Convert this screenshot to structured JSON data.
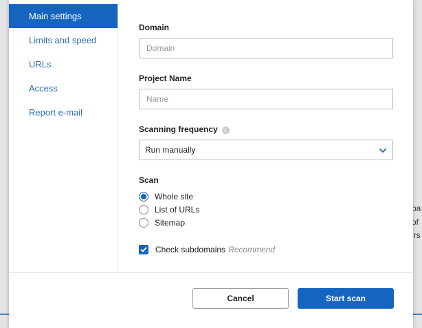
{
  "background": {
    "right_text_fragments": [
      "pa",
      "of",
      "irs"
    ]
  },
  "sidebar": {
    "items": [
      {
        "label": "Main settings",
        "active": true
      },
      {
        "label": "Limits and speed",
        "active": false
      },
      {
        "label": "URLs",
        "active": false
      },
      {
        "label": "Access",
        "active": false
      },
      {
        "label": "Report e-mail",
        "active": false
      }
    ]
  },
  "form": {
    "domain": {
      "label": "Domain",
      "placeholder": "Domain",
      "value": ""
    },
    "project_name": {
      "label": "Project Name",
      "placeholder": "Name",
      "value": ""
    },
    "scanning_frequency": {
      "label": "Scanning frequency",
      "info_icon": "info-icon",
      "selected": "Run manually"
    },
    "scan": {
      "label": "Scan",
      "options": [
        {
          "label": "Whole site",
          "checked": true
        },
        {
          "label": "List of URLs",
          "checked": false
        },
        {
          "label": "Sitemap",
          "checked": false
        }
      ]
    },
    "check_subdomains": {
      "label": "Check subdomains",
      "hint": "Recommend",
      "checked": true
    }
  },
  "footer": {
    "cancel_label": "Cancel",
    "start_label": "Start scan"
  },
  "colors": {
    "accent": "#1565c0",
    "link": "#2a6fba"
  }
}
